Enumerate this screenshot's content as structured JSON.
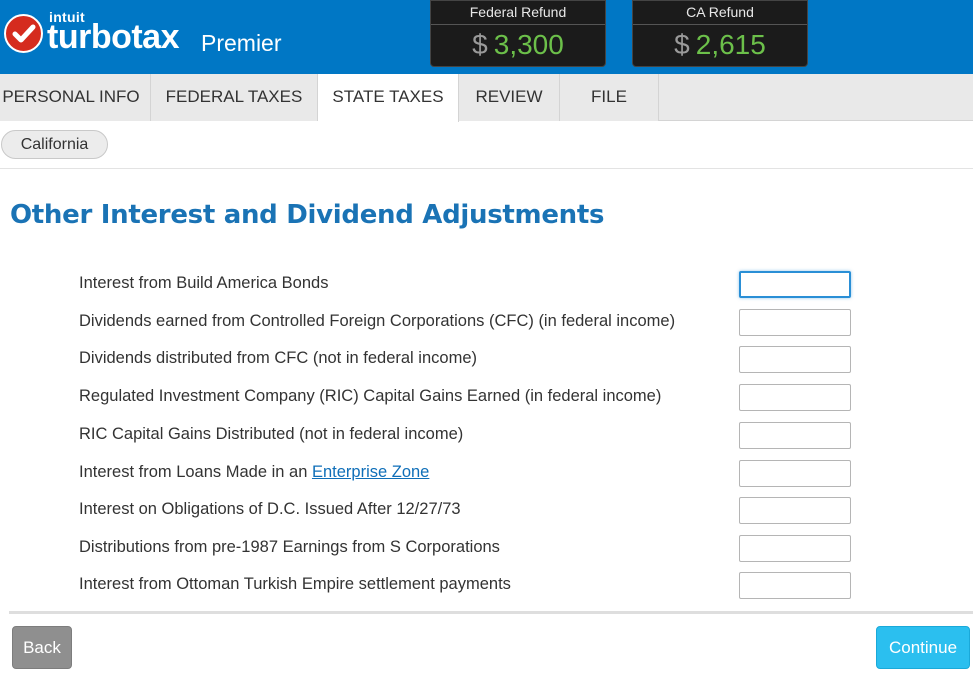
{
  "brand": {
    "intuit": "intuit",
    "product": "turbotax",
    "edition": "Premier",
    "logo_icon": "checkmark-icon",
    "logo_color": "#d52b1e",
    "header_color": "#0077c5"
  },
  "refunds": {
    "federal": {
      "label": "Federal Refund",
      "currency": "$",
      "amount": "3,300"
    },
    "state": {
      "label": "CA Refund",
      "currency": "$",
      "amount": "2,615"
    },
    "amount_color": "#6cc04a"
  },
  "tabs": [
    {
      "label": "PERSONAL INFO",
      "active": false
    },
    {
      "label": "FEDERAL TAXES",
      "active": false
    },
    {
      "label": "STATE TAXES",
      "active": true
    },
    {
      "label": "REVIEW",
      "active": false
    },
    {
      "label": "FILE",
      "active": false
    }
  ],
  "subnav": {
    "state_pill": "California"
  },
  "main": {
    "title": "Other Interest and Dividend Adjustments",
    "rows": [
      {
        "label": "Interest from Build America Bonds",
        "value": ""
      },
      {
        "label": "Dividends earned from Controlled Foreign Corporations (CFC) (in federal income)",
        "value": ""
      },
      {
        "label": "Dividends distributed from CFC (not in federal income)",
        "value": ""
      },
      {
        "label": "Regulated Investment Company (RIC) Capital Gains Earned (in federal income)",
        "value": ""
      },
      {
        "label": "RIC Capital Gains Distributed (not in federal income)",
        "value": ""
      },
      {
        "label_prefix": "Interest from Loans Made in an ",
        "link": "Enterprise Zone",
        "value": ""
      },
      {
        "label": "Interest on Obligations of D.C. Issued After 12/27/73",
        "value": ""
      },
      {
        "label": "Distributions from pre-1987 Earnings from S Corporations",
        "value": ""
      },
      {
        "label": "Interest from Ottoman Turkish Empire settlement payments",
        "value": ""
      }
    ]
  },
  "footer": {
    "back_label": "Back",
    "continue_label": "Continue",
    "continue_color": "#2bbfef"
  }
}
